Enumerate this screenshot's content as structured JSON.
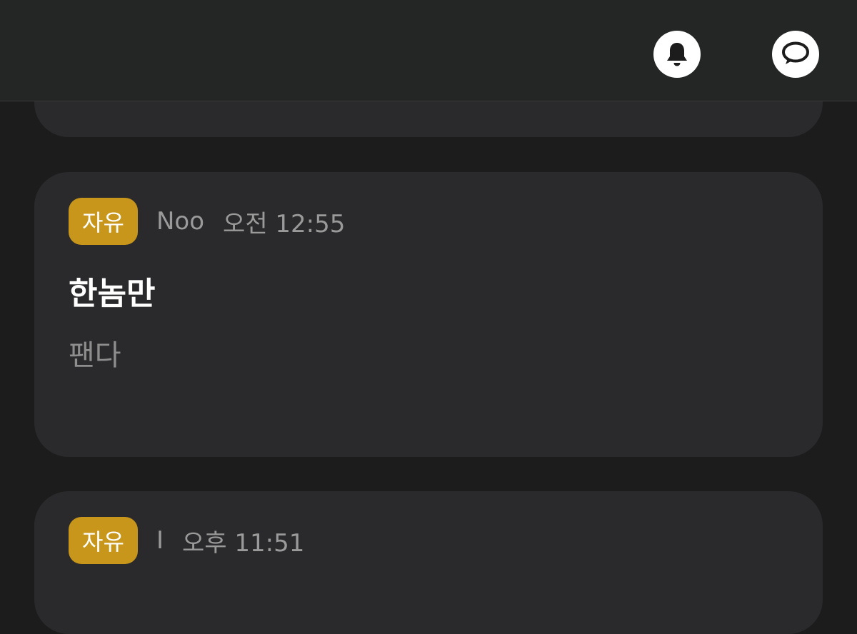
{
  "header": {
    "notification_icon": "bell-icon",
    "chat_icon": "chat-bubble-icon",
    "background": "#242525"
  },
  "colors": {
    "page_background": "#1c1c1c",
    "card_background": "#2a2a2c",
    "badge_background": "#c8961a",
    "meta_text": "#9a9a9a",
    "title_text": "#ffffff",
    "body_text": "#8e8e8e"
  },
  "posts": [
    {
      "category": "자유",
      "author": "Noo",
      "time": "오전 12:55",
      "title": "한놈만",
      "body": "팬다"
    },
    {
      "category": "자유",
      "author": "I",
      "time": "오후 11:51"
    }
  ]
}
